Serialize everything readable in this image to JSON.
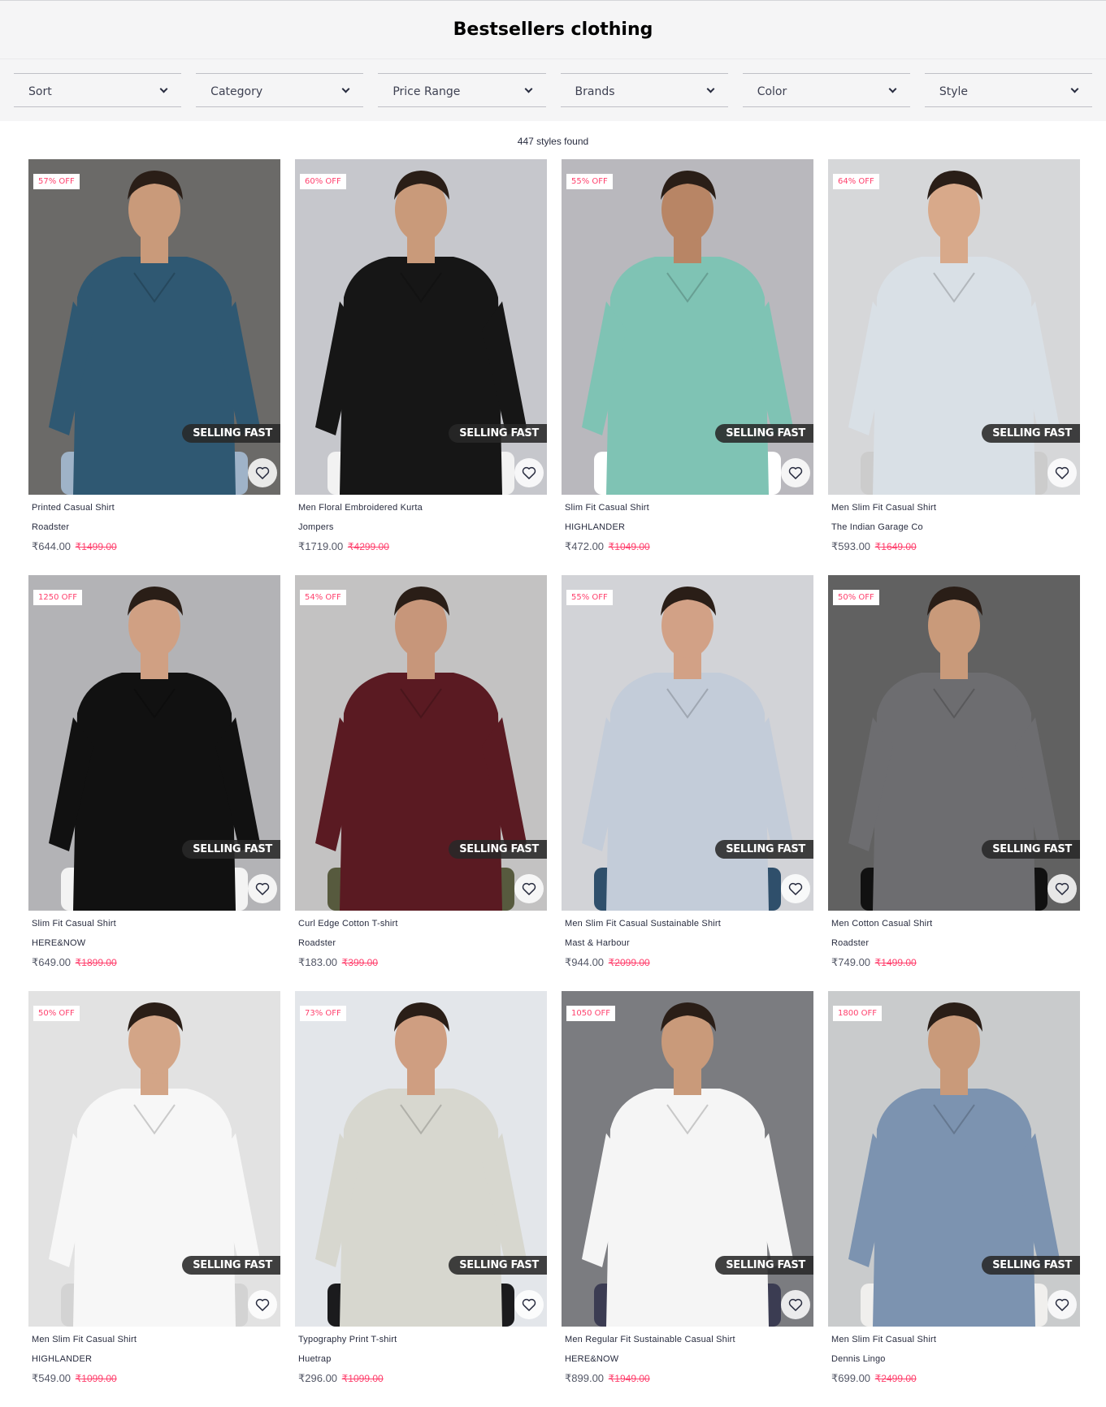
{
  "page": {
    "title": "Bestsellers clothing",
    "results_text": "447 styles found"
  },
  "filters": [
    {
      "label": "Sort"
    },
    {
      "label": "Category"
    },
    {
      "label": "Price Range"
    },
    {
      "label": "Brands"
    },
    {
      "label": "Color"
    },
    {
      "label": "Style"
    }
  ],
  "badges": {
    "selling_fast": "SELLING FAST"
  },
  "products": [
    {
      "name": "Printed Casual Shirt",
      "brand": "Roadster",
      "price": "₹644.00",
      "mrp": "₹1499.00",
      "discount": "57% OFF",
      "bg": "#6b6a68",
      "shirt": "#2f5872",
      "pants": "#9fb3c8",
      "skin": "#c99a7a"
    },
    {
      "name": "Men Floral Embroidered Kurta",
      "brand": "Jompers",
      "price": "₹1719.00",
      "mrp": "₹4299.00",
      "discount": "60% OFF",
      "bg": "#c6c7cc",
      "shirt": "#161616",
      "pants": "#f2f2f2",
      "skin": "#c99a7a"
    },
    {
      "name": "Slim Fit Casual Shirt",
      "brand": "HIGHLANDER",
      "price": "₹472.00",
      "mrp": "₹1049.00",
      "discount": "55% OFF",
      "bg": "#b9b8bd",
      "shirt": "#7fc3b4",
      "pants": "#ffffff",
      "skin": "#b88565"
    },
    {
      "name": "Men Slim Fit Casual Shirt",
      "brand": "The Indian Garage Co",
      "price": "₹593.00",
      "mrp": "₹1649.00",
      "discount": "64% OFF",
      "bg": "#d6d7d9",
      "shirt": "#d9e0e6",
      "pants": "#cccccc",
      "skin": "#d8a98a"
    },
    {
      "name": "Slim Fit Casual Shirt",
      "brand": "HERE&NOW",
      "price": "₹649.00",
      "mrp": "₹1899.00",
      "discount": "1250 OFF",
      "bg": "#b3b3b6",
      "shirt": "#111111",
      "pants": "#f3f3f3",
      "skin": "#d0a083"
    },
    {
      "name": "Curl Edge Cotton T-shirt",
      "brand": "Roadster",
      "price": "₹183.00",
      "mrp": "₹399.00",
      "discount": "54% OFF",
      "bg": "#c3c2c2",
      "shirt": "#5a1a22",
      "pants": "#575a3e",
      "skin": "#c7967a"
    },
    {
      "name": "Men Slim Fit Casual Sustainable Shirt",
      "brand": "Mast & Harbour",
      "price": "₹944.00",
      "mrp": "₹2099.00",
      "discount": "55% OFF",
      "bg": "#d2d3d7",
      "shirt": "#c3ccd9",
      "pants": "#2f4f6b",
      "skin": "#d2a186"
    },
    {
      "name": "Men Cotton Casual Shirt",
      "brand": "Roadster",
      "price": "₹749.00",
      "mrp": "₹1499.00",
      "discount": "50% OFF",
      "bg": "#616161",
      "shirt": "#6d6d70",
      "pants": "#111111",
      "skin": "#c99a7a"
    },
    {
      "name": "Men Slim Fit Casual Shirt",
      "brand": "HIGHLANDER",
      "price": "₹549.00",
      "mrp": "₹1099.00",
      "discount": "50% OFF",
      "bg": "#e2e2e2",
      "shirt": "#f7f7f7",
      "pants": "#d3d3d3",
      "skin": "#d3a587"
    },
    {
      "name": "Typography Print T-shirt",
      "brand": "Huetrap",
      "price": "₹296.00",
      "mrp": "₹1099.00",
      "discount": "73% OFF",
      "bg": "#e3e6ea",
      "shirt": "#d7d7cf",
      "pants": "#1b1b1d",
      "skin": "#cf9e81"
    },
    {
      "name": "Men Regular Fit Sustainable Casual Shirt",
      "brand": "HERE&NOW",
      "price": "₹899.00",
      "mrp": "₹1949.00",
      "discount": "1050 OFF",
      "bg": "#7b7c80",
      "shirt": "#f5f5f5",
      "pants": "#3b3c52",
      "skin": "#c99a7a"
    },
    {
      "name": "Men Slim Fit Casual Shirt",
      "brand": "Dennis Lingo",
      "price": "₹699.00",
      "mrp": "₹2499.00",
      "discount": "1800 OFF",
      "bg": "#c9cbcc",
      "shirt": "#7c93b0",
      "pants": "#f0efed",
      "skin": "#c99a7a"
    }
  ]
}
